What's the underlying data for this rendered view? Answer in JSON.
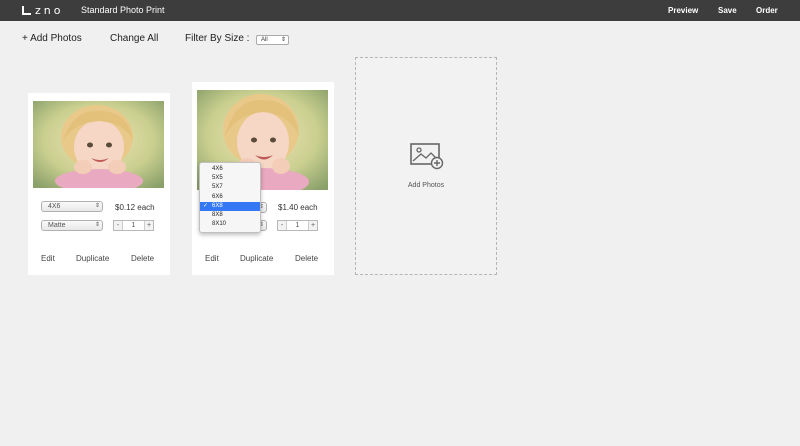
{
  "header": {
    "logo_text": "zno",
    "title": "Standard Photo Print",
    "nav": {
      "preview": "Preview",
      "save": "Save",
      "order": "Order"
    }
  },
  "toolbar": {
    "add_photos": "+ Add Photos",
    "change_all": "Change All",
    "filter_label": "Filter By Size :",
    "filter_value": "All"
  },
  "cards": [
    {
      "size": "4X6",
      "paper": "Matte",
      "price": "$0.12 each",
      "quantity": "1",
      "edit": "Edit",
      "duplicate": "Duplicate",
      "delete": "Delete"
    },
    {
      "price": "$1.40 each",
      "quantity": "1",
      "edit": "Edit",
      "duplicate": "Duplicate",
      "delete": "Delete"
    }
  ],
  "size_dropdown": {
    "options": [
      "4X6",
      "5X5",
      "5X7",
      "6X6",
      "6X8",
      "8X8",
      "8X10"
    ],
    "selected": "6X8"
  },
  "stepper": {
    "minus": "-",
    "plus": "+"
  },
  "add_tile": {
    "label": "Add Photos"
  },
  "colors": {
    "topbar": "#3d3d3d",
    "selection": "#3478f6",
    "background": "#f0f0f0"
  }
}
